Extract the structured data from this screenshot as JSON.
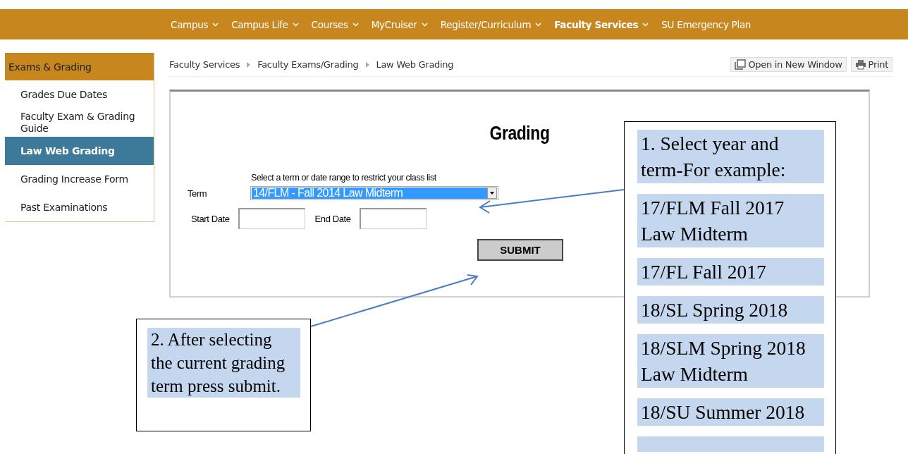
{
  "nav": [
    {
      "label": "Campus",
      "dropdown": true,
      "selected": false
    },
    {
      "label": "Campus Life",
      "dropdown": true,
      "selected": false
    },
    {
      "label": "Courses",
      "dropdown": true,
      "selected": false
    },
    {
      "label": "MyCruiser",
      "dropdown": true,
      "selected": false
    },
    {
      "label": "Register/Curriculum",
      "dropdown": true,
      "selected": false
    },
    {
      "label": "Faculty Services",
      "dropdown": true,
      "selected": true
    },
    {
      "label": "SU Emergency Plan",
      "dropdown": false,
      "selected": false
    }
  ],
  "sidebar": {
    "title": "Exams & Grading",
    "items": [
      {
        "label": "Grades Due Dates",
        "selected": false
      },
      {
        "label": "Faculty Exam & Grading Guide",
        "selected": false
      },
      {
        "label": "Law Web Grading",
        "selected": true
      },
      {
        "label": "Grading Increase Form",
        "selected": false
      },
      {
        "label": "Past Examinations",
        "selected": false
      }
    ]
  },
  "breadcrumbs": [
    "Faculty Services",
    "Faculty Exams/Grading",
    "Law Web Grading"
  ],
  "actions": [
    {
      "kind": "window",
      "label": "Open in New Window"
    },
    {
      "kind": "print",
      "label": "Print"
    }
  ],
  "form": {
    "title": "Grading",
    "hint": "Select a term or date range to restrict your class list",
    "term_label": "Term",
    "term_value": "14/FLM - Fall 2014 Law Midterm",
    "start_label": "Start Date",
    "end_label": "End Date",
    "submit": "SUBMIT"
  },
  "submit_callout": {
    "blocks": [
      "2. After selecting the current grading term press submit."
    ]
  },
  "term_callout": {
    "blocks": [
      "1. Select year and term-For example:",
      "17/FLM Fall 2017 Law Midterm",
      "17/FL Fall 2017",
      "18/SL Spring 2018",
      "18/SLM Spring 2018 Law Midterm",
      "18/SU Summer 2018"
    ]
  }
}
